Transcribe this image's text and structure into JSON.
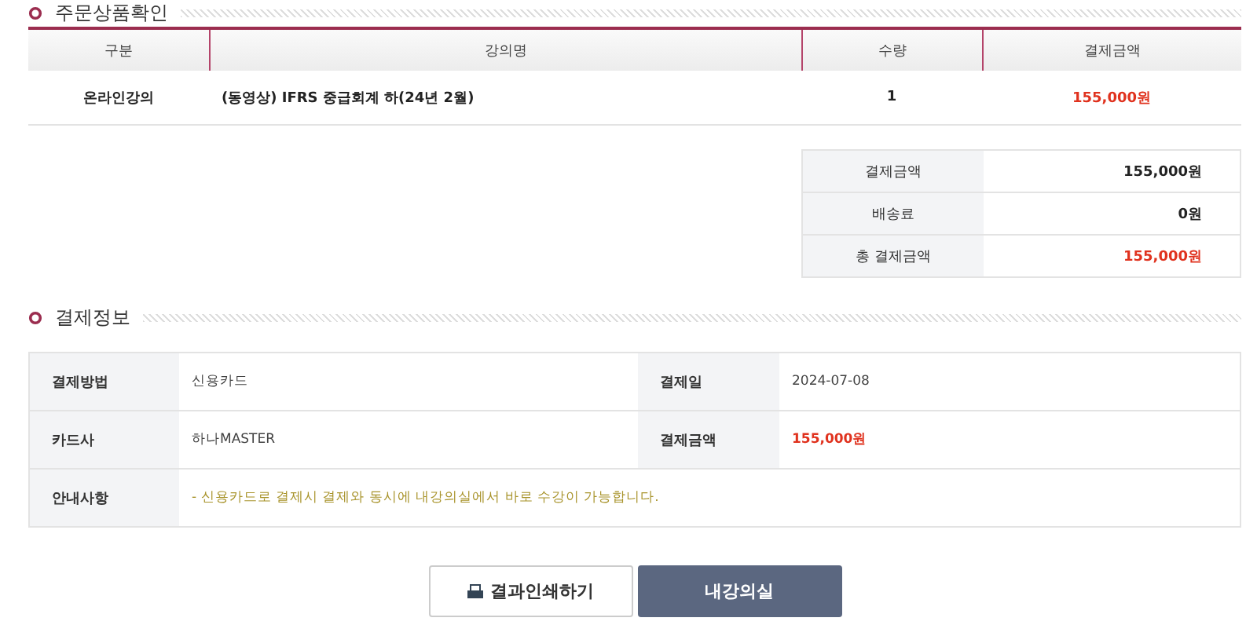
{
  "order_section": {
    "title": "주문상품확인",
    "columns": [
      "구분",
      "강의명",
      "수량",
      "결제금액"
    ],
    "rows": [
      {
        "category": "온라인강의",
        "course": "(동영상) IFRS 중급회계 하(24년 2월)",
        "quantity": "1",
        "amount": "155,000원"
      }
    ]
  },
  "summary": [
    {
      "label": "결제금액",
      "value": "155,000원",
      "highlight": false
    },
    {
      "label": "배송료",
      "value": "0원",
      "highlight": false
    },
    {
      "label": "총 결제금액",
      "value": "155,000원",
      "highlight": true
    }
  ],
  "payment_section": {
    "title": "결제정보",
    "rows": [
      {
        "cells": [
          {
            "label": "결제방법",
            "value": "신용카드",
            "kind": "plain"
          },
          {
            "label": "결제일",
            "value": "2024-07-08",
            "kind": "plain"
          }
        ]
      },
      {
        "cells": [
          {
            "label": "카드사",
            "value": "하나MASTER",
            "kind": "plain"
          },
          {
            "label": "결제금액",
            "value": "155,000원",
            "kind": "amount"
          }
        ]
      },
      {
        "cells": [
          {
            "label": "안내사항",
            "value": "- 신용카드로 결제시 결제와 동시에 내강의실에서 바로 수강이 가능합니다.",
            "kind": "notice"
          }
        ]
      }
    ]
  },
  "buttons": [
    {
      "label": "결과인쇄하기",
      "kind": "print"
    },
    {
      "label": "내강의실",
      "kind": "primary"
    }
  ]
}
